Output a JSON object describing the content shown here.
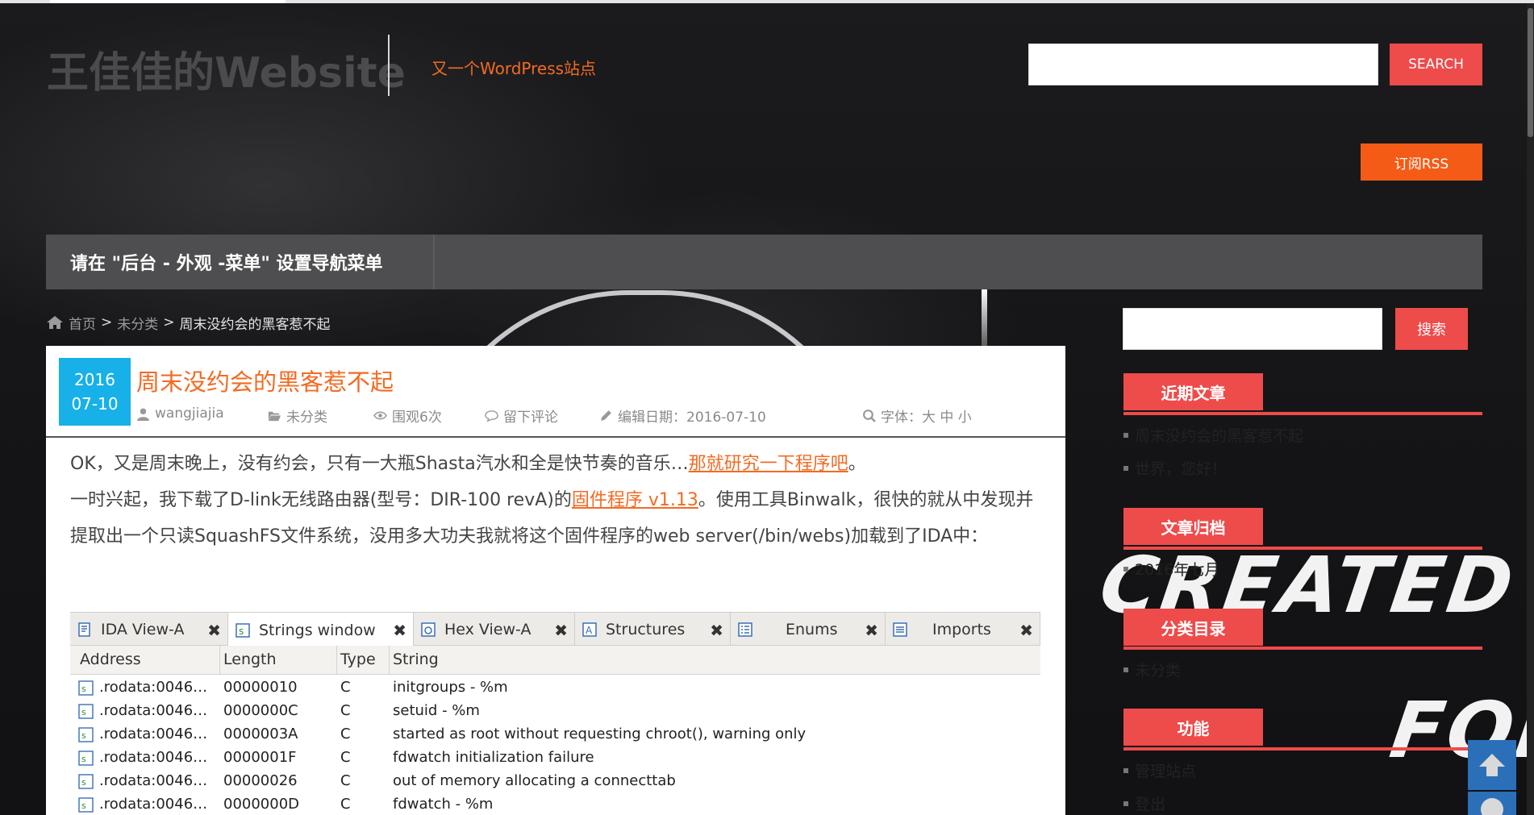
{
  "site": {
    "title": "王佳佳的Website",
    "tagline": "又一个WordPress站点"
  },
  "header": {
    "search_placeholder": "",
    "search_button": "SEARCH",
    "rss_button": "订阅RSS"
  },
  "nav": {
    "menu_hint": "请在 \"后台 - 外观 -菜单\" 设置导航菜单"
  },
  "breadcrumb": {
    "home": "首页",
    "separator": ">",
    "category": "未分类",
    "current": "周末没约会的黑客惹不起"
  },
  "post": {
    "date_year": "2016",
    "date_md": "07-10",
    "title": "周末没约会的黑客惹不起",
    "meta": {
      "author": "wangjiajia",
      "category": "未分类",
      "views": "围观6次",
      "comment": "留下评论",
      "edit_date": "编辑日期：2016-07-10",
      "font_size": "字体：大 中 小"
    },
    "paragraph1_text": "OK，又是周末晚上，没有约会，只有一大瓶Shasta汽水和全是快节奏的音乐…",
    "paragraph1_link": "那就研究一下程序吧",
    "paragraph1_end": "。",
    "paragraph2_text": "一时兴起，我下载了D-link无线路由器(型号：DIR-100 revA)的",
    "paragraph2_link": "固件程序 v1.13",
    "paragraph2_rest": "。使用工具Binwalk，很快的就从中发现并提取出一个只读SquashFS文件系统，没用多大功夫我就将这个固件程序的web server(/bin/webs)加载到了IDA中："
  },
  "ida": {
    "tabs": [
      {
        "label": "IDA View-A",
        "close": "✖"
      },
      {
        "label": "Strings window",
        "close": "✖"
      },
      {
        "label": "Hex View-A",
        "close": "✖"
      },
      {
        "label": "Structures",
        "close": "✖"
      },
      {
        "label": "Enums",
        "close": "✖"
      },
      {
        "label": "Imports",
        "close": "✖"
      }
    ],
    "columns": [
      "Address",
      "Length",
      "Type",
      "String"
    ],
    "rows": [
      {
        "address": ".rodata:0046…",
        "length": "00000010",
        "type": "C",
        "string": "initgroups - %m"
      },
      {
        "address": ".rodata:0046…",
        "length": "0000000C",
        "type": "C",
        "string": "setuid - %m"
      },
      {
        "address": ".rodata:0046…",
        "length": "0000003A",
        "type": "C",
        "string": "started as root without requesting chroot(), warning only"
      },
      {
        "address": ".rodata:0046…",
        "length": "0000001F",
        "type": "C",
        "string": "fdwatch initialization failure"
      },
      {
        "address": ".rodata:0046…",
        "length": "00000026",
        "type": "C",
        "string": "out of memory allocating a connecttab"
      },
      {
        "address": ".rodata:0046…",
        "length": "0000000D",
        "type": "C",
        "string": "fdwatch - %m"
      }
    ]
  },
  "sidebar": {
    "search_button": "搜索",
    "recent_title": "近期文章",
    "recent": [
      "周末没约会的黑客惹不起",
      "世界，您好！"
    ],
    "archive_title": "文章归档",
    "archive": [
      "2016年七月"
    ],
    "categories_title": "分类目录",
    "categories": [
      "未分类"
    ],
    "meta_title": "功能",
    "meta": [
      "管理站点",
      "登出"
    ]
  },
  "background": {
    "line1": "CREATED BY",
    "line2": "FOR"
  },
  "colors": {
    "accent_red": "#ee4b4b",
    "accent_orange": "#f26b23",
    "rss_orange": "#f45b17",
    "date_blue": "#17b0e8",
    "nav_gray": "#4e4e50"
  }
}
